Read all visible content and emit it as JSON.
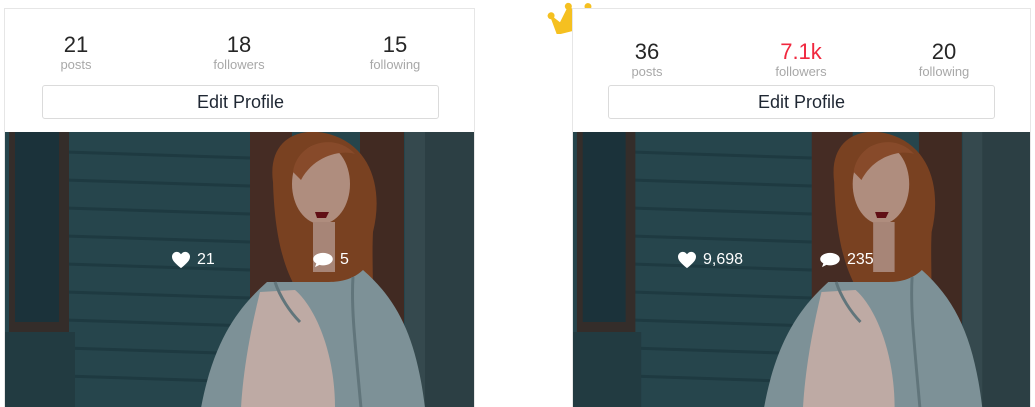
{
  "cards": [
    {
      "stats": {
        "posts": {
          "value": "21",
          "label": "posts"
        },
        "followers": {
          "value": "18",
          "label": "followers"
        },
        "following": {
          "value": "15",
          "label": "following"
        }
      },
      "edit_button_label": "Edit Profile",
      "photo": {
        "likes": "21",
        "comments": "5"
      }
    },
    {
      "stats": {
        "posts": {
          "value": "36",
          "label": "posts"
        },
        "followers": {
          "value": "7.1k",
          "label": "followers"
        },
        "following": {
          "value": "20",
          "label": "following"
        }
      },
      "edit_button_label": "Edit Profile",
      "photo": {
        "likes": "9,698",
        "comments": "235"
      }
    }
  ],
  "colors": {
    "highlight_followers": "#f0283f",
    "crown": "#f5c020",
    "stat_number": "#262626",
    "stat_label": "#a8a8a8"
  },
  "icons": {
    "crown": "crown-icon",
    "like": "heart-icon",
    "comment": "speech-bubble-icon"
  }
}
